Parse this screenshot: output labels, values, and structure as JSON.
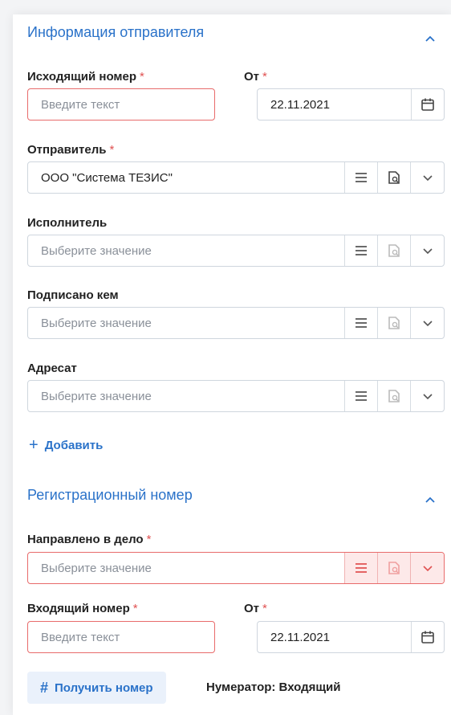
{
  "sender_section": {
    "title": "Информация отправителя",
    "outgoing_number": {
      "label": "Исходящий номер",
      "required_mark": "*",
      "placeholder": "Введите текст"
    },
    "date": {
      "label": "От",
      "required_mark": "*",
      "value": "22.11.2021"
    },
    "sender": {
      "label": "Отправитель",
      "required_mark": "*",
      "value": "ООО \"Система ТЕЗИС\""
    },
    "executor": {
      "label": "Исполнитель",
      "placeholder": "Выберите значение"
    },
    "signed_by": {
      "label": "Подписано кем",
      "placeholder": "Выберите значение"
    },
    "addressee": {
      "label": "Адресат",
      "placeholder": "Выберите значение"
    },
    "add_link": {
      "icon": "+",
      "label": "Добавить"
    }
  },
  "registration_section": {
    "title": "Регистрационный номер",
    "sent_to_case": {
      "label": "Направлено в дело",
      "required_mark": "*",
      "placeholder": "Выберите значение"
    },
    "incoming_number": {
      "label": "Входящий номер",
      "required_mark": "*",
      "placeholder": "Введите текст"
    },
    "date": {
      "label": "От",
      "required_mark": "*",
      "value": "22.11.2021"
    },
    "get_number_button": {
      "icon": "#",
      "label": "Получить номер"
    },
    "numerator": "Нумератор: Входящий"
  },
  "colors": {
    "accent": "#2a72c9",
    "error": "#e86b6b",
    "required": "#e05252"
  },
  "icons": [
    "chevron-up-icon",
    "calendar-icon",
    "list-icon",
    "lookup-icon",
    "chevron-down-icon",
    "plus-icon",
    "hash-icon"
  ]
}
